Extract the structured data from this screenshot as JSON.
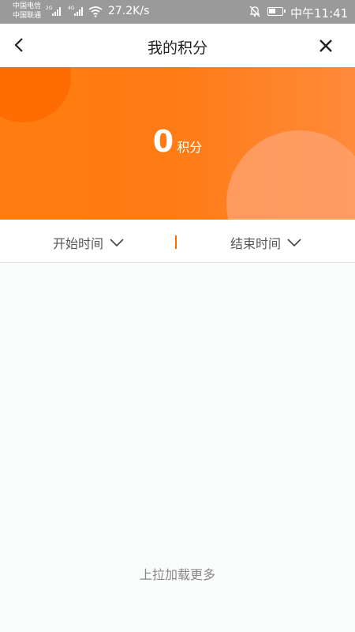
{
  "status_bar": {
    "carrier_1": "中国电信",
    "carrier_2": "中国联通",
    "network_badge_1": "2G",
    "network_badge_2": "4G",
    "speed": "27.2K/s",
    "time": "中午11:41",
    "icons": [
      "signal-icon",
      "wifi-icon",
      "bell-muted-icon",
      "battery-icon"
    ]
  },
  "nav": {
    "title": "我的积分",
    "back_icon": "chevron-left-icon",
    "close_icon": "close-icon"
  },
  "points": {
    "value": "0",
    "unit": "积分"
  },
  "filters": {
    "start_label": "开始时间",
    "end_label": "结束时间"
  },
  "footer": {
    "load_more": "上拉加载更多"
  },
  "colors": {
    "accent": "#ff7a12",
    "divider_accent": "#ff6a00",
    "status_bar": "#9a9a9a"
  }
}
